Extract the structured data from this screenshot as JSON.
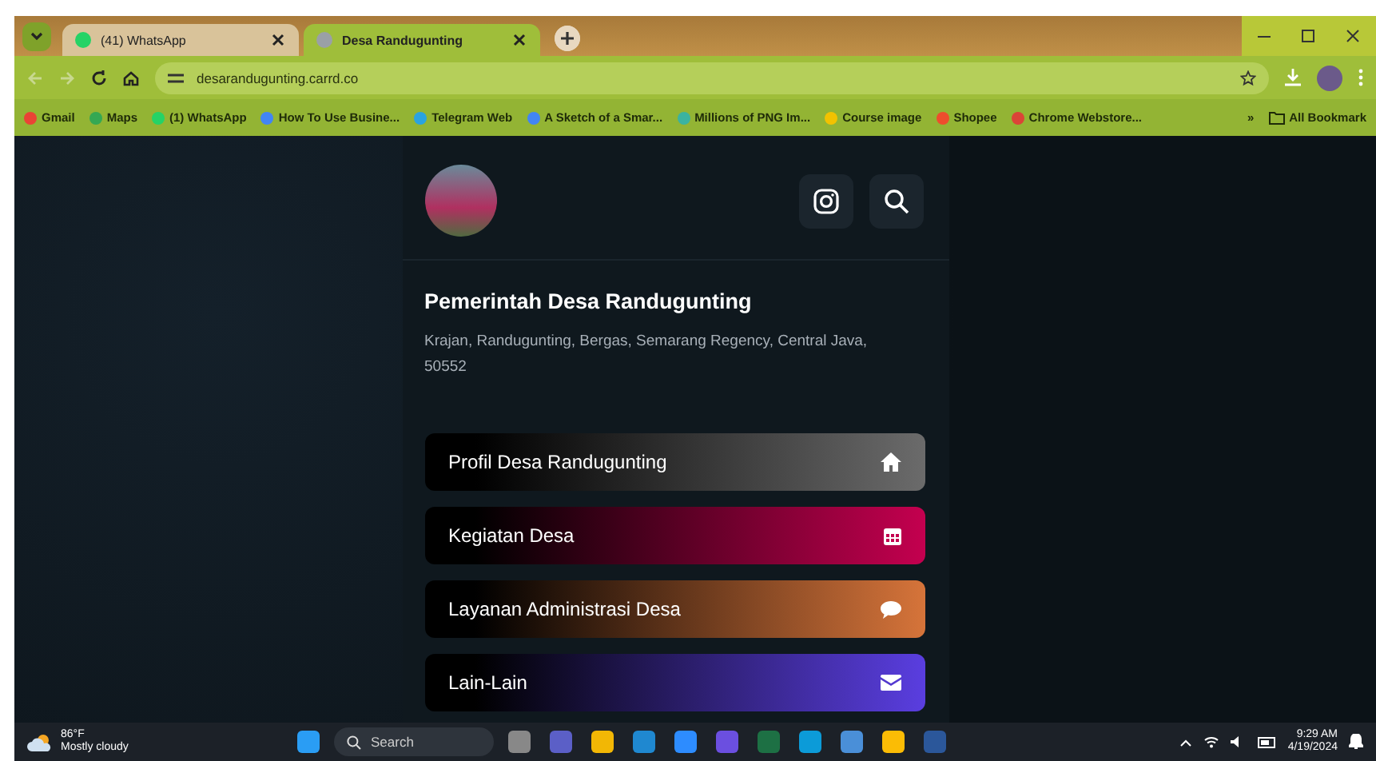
{
  "browser": {
    "tabs": [
      {
        "title": "(41) WhatsApp",
        "selected": false,
        "color": "#25d366"
      },
      {
        "title": "Desa Randugunting",
        "selected": true,
        "color": "#9aa0a6"
      }
    ],
    "url": "desarandugunting.carrd.co",
    "bookmarks": [
      {
        "label": "Gmail",
        "color": "#ea4335"
      },
      {
        "label": "Maps",
        "color": "#34a853"
      },
      {
        "label": "(1) WhatsApp",
        "color": "#25d366"
      },
      {
        "label": "How To Use Busine...",
        "color": "#4285f4"
      },
      {
        "label": "Telegram Web",
        "color": "#2aa3e0"
      },
      {
        "label": "A Sketch of a Smar...",
        "color": "#4285f4"
      },
      {
        "label": "Millions of PNG Im...",
        "color": "#3bb3a0"
      },
      {
        "label": "Course image",
        "color": "#f2c200"
      },
      {
        "label": "Shopee",
        "color": "#ee4d2d"
      },
      {
        "label": "Chrome Webstore...",
        "color": "#db4437"
      }
    ],
    "more": "»",
    "all_bookmarks": "All Bookmark"
  },
  "page": {
    "title": "Pemerintah Desa Randugunting",
    "address": "Krajan, Randugunting, Bergas, Semarang Regency, Central Java, 50552",
    "links": [
      {
        "label": "Profil Desa Randugunting",
        "kind": "home",
        "color": "#6b6b6b"
      },
      {
        "label": "Kegiatan Desa",
        "kind": "calendar",
        "color": "#c4004f"
      },
      {
        "label": "Layanan Administrasi Desa",
        "kind": "chat",
        "color": "#d6743a"
      },
      {
        "label": "Lain-Lain",
        "kind": "mail",
        "color": "#5a3ee0"
      }
    ]
  },
  "taskbar": {
    "temperature": "86°F",
    "weather": "Mostly cloudy",
    "search_placeholder": "Search",
    "time": "9:29 AM",
    "date": "4/19/2024"
  }
}
